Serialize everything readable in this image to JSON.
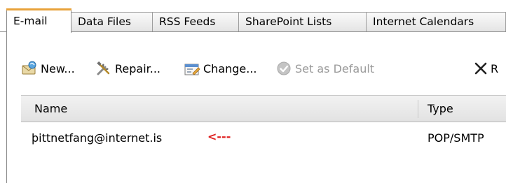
{
  "tabs": [
    {
      "label": "E-mail",
      "active": true
    },
    {
      "label": "Data Files",
      "active": false
    },
    {
      "label": "RSS Feeds",
      "active": false
    },
    {
      "label": "SharePoint Lists",
      "active": false
    },
    {
      "label": "Internet Calendars",
      "active": false
    }
  ],
  "toolbar": {
    "new_label": "New...",
    "repair_label": "Repair...",
    "change_label": "Change...",
    "set_default_label": "Set as Default",
    "remove_label": "R",
    "icons": {
      "new": "new-account-icon",
      "repair": "repair-tools-icon",
      "change": "change-account-icon",
      "set_default": "checkmark-circle-icon",
      "remove": "remove-x-icon"
    }
  },
  "list": {
    "columns": {
      "name": "Name",
      "type": "Type"
    },
    "rows": [
      {
        "name": "þittnetfang@internet.is",
        "annotation": "<---",
        "type": "POP/SMTP"
      }
    ]
  },
  "colors": {
    "active_tab_accent": "#e8a23a",
    "annotation_arrow": "#e02020",
    "disabled_text": "#9a9a9a"
  }
}
